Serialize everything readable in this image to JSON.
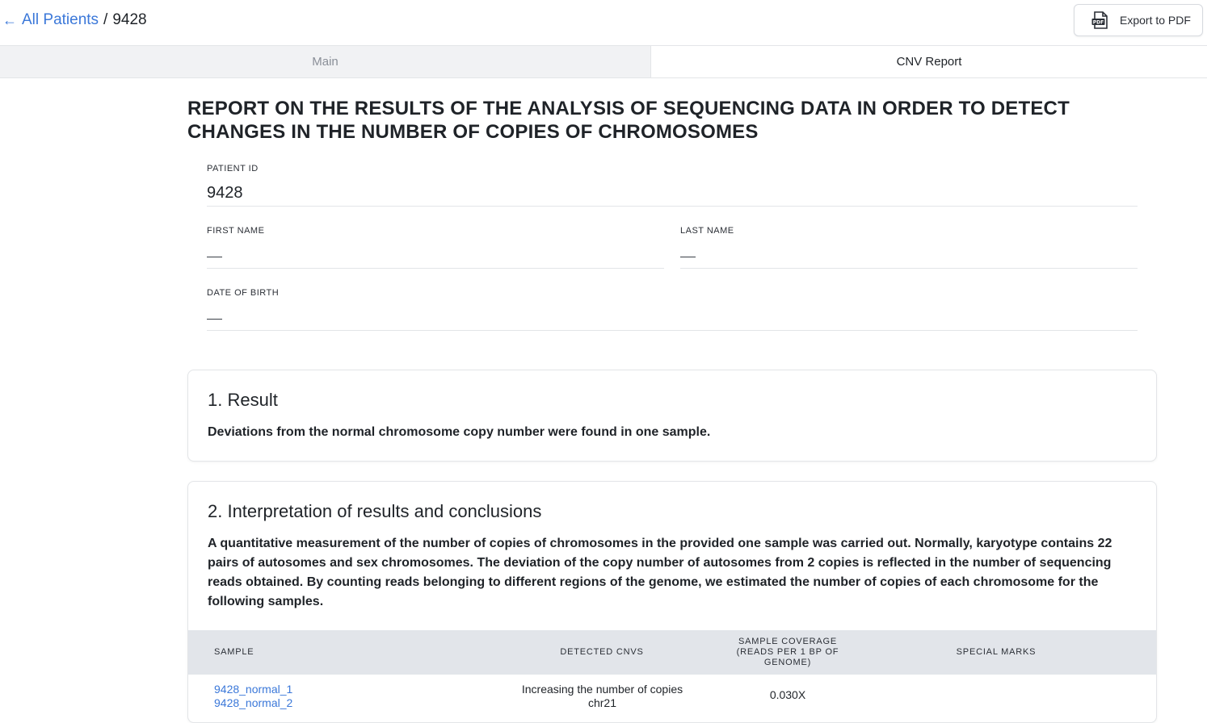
{
  "breadcrumb": {
    "back_label": "All Patients",
    "separator": "/",
    "current": "9428"
  },
  "toolbar": {
    "export_label": "Export to PDF",
    "export_icon": "pdf-file-icon"
  },
  "tabs": [
    {
      "label": "Main",
      "active": false
    },
    {
      "label": "CNV Report",
      "active": true
    }
  ],
  "report": {
    "title": "REPORT ON THE RESULTS OF THE ANALYSIS OF SEQUENCING DATA IN ORDER TO DETECT CHANGES IN THE NUMBER OF COPIES OF CHROMOSOMES"
  },
  "fields": {
    "patient_id": {
      "label": "PATIENT ID",
      "value": "9428"
    },
    "first_name": {
      "label": "FIRST NAME",
      "value": ""
    },
    "last_name": {
      "label": "LAST NAME",
      "value": ""
    },
    "date_of_birth": {
      "label": "DATE OF BIRTH",
      "value": ""
    }
  },
  "sections": {
    "result": {
      "title": "1. Result",
      "text": "Deviations from the normal chromosome copy number were found in one sample."
    },
    "interpretation": {
      "title": "2. Interpretation of results and conclusions",
      "text": "A quantitative measurement of the number of copies of chromosomes in the provided one sample was carried out. Normally, karyotype contains 22 pairs of autosomes and sex chromosomes. The deviation of the copy number of autosomes from 2 copies is reflected in the number of sequencing reads obtained. By counting reads belonging to different regions of the genome, we estimated the number of copies of each chromosome for the following samples."
    }
  },
  "table": {
    "headers": {
      "sample": "SAMPLE",
      "detected_cnvs": "DETECTED CNVS",
      "coverage_line1": "SAMPLE COVERAGE",
      "coverage_line2": "(READS PER 1 BP OF",
      "coverage_line3": "GENOME)",
      "special_marks": "SPECIAL MARKS"
    },
    "rows": [
      {
        "samples": [
          "9428_normal_1",
          "9428_normal_2"
        ],
        "cnv_line1": "Increasing the number of copies",
        "cnv_line2": "chr21",
        "coverage": "0.030X",
        "special_marks": ""
      }
    ]
  },
  "colors": {
    "link": "#3b78d9",
    "table_header_bg": "#e2e5ea",
    "inactive_tab_bg": "#f1f2f4"
  }
}
